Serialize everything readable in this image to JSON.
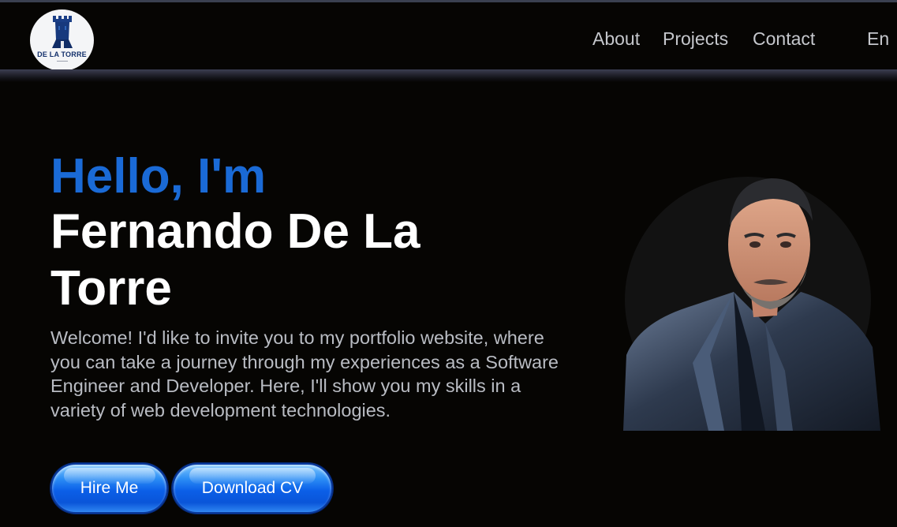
{
  "header": {
    "logo": {
      "text": "DE LA TORRE",
      "icon": "tower-logo-icon"
    },
    "nav": [
      {
        "label": "About"
      },
      {
        "label": "Projects"
      },
      {
        "label": "Contact"
      }
    ],
    "language": "En"
  },
  "hero": {
    "greeting": "Hello, I'm",
    "name": "Fernando De La Torre",
    "description": "Welcome! I'd like to invite you to my portfolio website, where you can take a journey through my experiences as a Software Engineer and Developer. Here, I'll show you my skills in a variety of web development technologies.",
    "buttons": {
      "hire": "Hire Me",
      "download_cv": "Download CV"
    },
    "portrait": "profile-photo"
  },
  "colors": {
    "background": "#060503",
    "greeting": "#1a6ad6",
    "name": "#ffffff",
    "description": "#b9bcc3",
    "nav_link": "#c5c7cc",
    "button": "#0b5fe8"
  }
}
